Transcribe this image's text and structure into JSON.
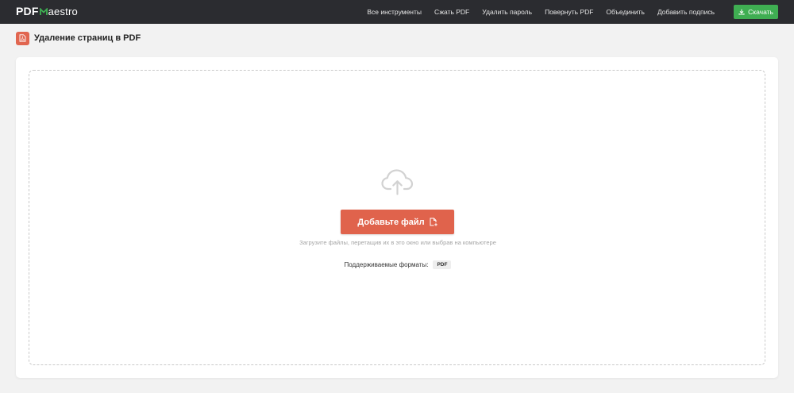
{
  "header": {
    "logo": {
      "pdf": "PDF",
      "rest": "aestro"
    },
    "nav": [
      {
        "label": "Все инструменты"
      },
      {
        "label": "Сжать PDF"
      },
      {
        "label": "Удалить пароль"
      },
      {
        "label": "Повернуть PDF"
      },
      {
        "label": "Объединить"
      },
      {
        "label": "Добавить подпись"
      }
    ],
    "download_label": "Скачать"
  },
  "page": {
    "title": "Удаление страниц в PDF"
  },
  "dropzone": {
    "add_file_label": "Добавьте файл",
    "hint": "Загрузите файлы, перетащив их в это окно или выбрав на компьютере",
    "formats_label": "Поддерживаемые форматы:",
    "formats": [
      "PDF"
    ]
  },
  "colors": {
    "header_bg": "#2b2c30",
    "accent_red": "#e0634c",
    "accent_green": "#3fae52",
    "page_bg": "#f2f2f2"
  },
  "icons": {
    "logo_mark": "m-logo-icon",
    "download": "download-icon",
    "title": "pdf-file-icon",
    "upload": "cloud-upload-icon",
    "add_file": "file-add-icon"
  }
}
